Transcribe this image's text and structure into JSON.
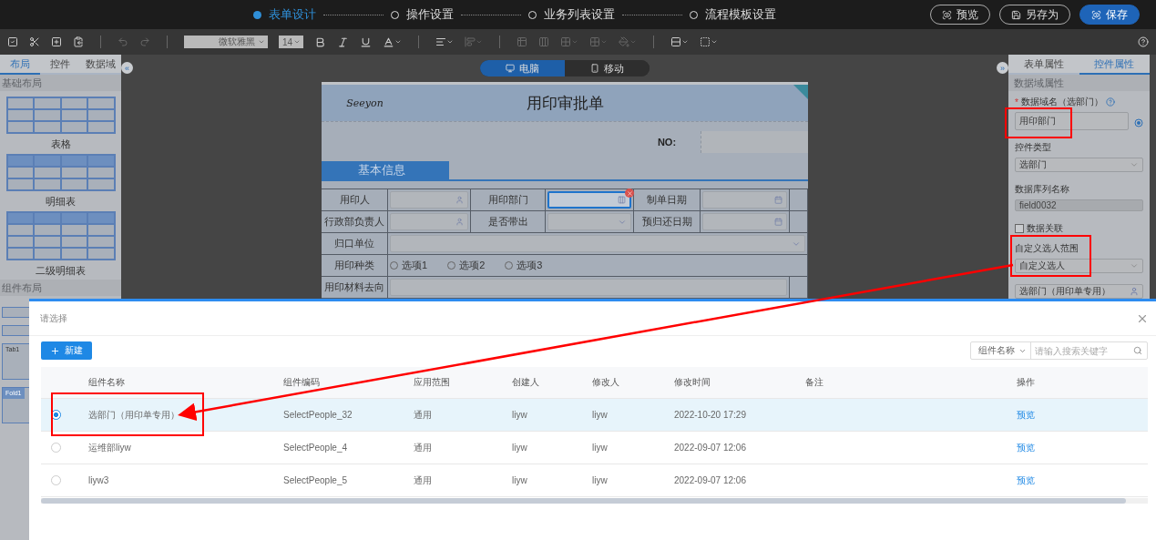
{
  "top_bar": {
    "steps": [
      {
        "label": "表单设计",
        "selected": true
      },
      {
        "label": "操作设置",
        "selected": false
      },
      {
        "label": "业务列表设置",
        "selected": false
      },
      {
        "label": "流程模板设置",
        "selected": false
      }
    ],
    "buttons": [
      {
        "label": "预览",
        "kind": "outline"
      },
      {
        "label": "另存为",
        "kind": "save-as"
      },
      {
        "label": "保存",
        "kind": "primary"
      }
    ]
  },
  "toolbar": {
    "font": "微软雅黑",
    "size": "14"
  },
  "left_panel": {
    "tabs": [
      {
        "label": "布局",
        "selected": true
      },
      {
        "label": "控件",
        "selected": false
      },
      {
        "label": "数据域",
        "selected": false
      }
    ],
    "section": "基础布局",
    "items": [
      {
        "label": "表格",
        "kind": "table"
      },
      {
        "label": "明细表",
        "kind": "detail"
      },
      {
        "label": "二级明细表",
        "kind": "detail2"
      }
    ],
    "section_2": "组件布局",
    "collapse": "«",
    "components": [
      {
        "kind": "bar"
      },
      {
        "kind": "bar"
      },
      {
        "label": "Tab1",
        "kind": "tab"
      },
      {
        "label": "Fold1",
        "kind": "fold"
      }
    ]
  },
  "view_toggle": [
    {
      "label": "电脑",
      "kind": "desktop",
      "selected": true
    },
    {
      "label": "移动",
      "kind": "mobile",
      "selected": false
    }
  ],
  "form": {
    "logo": "Seeyon",
    "title": "用印审批单",
    "no_label": "NO:",
    "section": "基本信息",
    "rows": [
      [
        {
          "kind": "label",
          "text": "用印人"
        },
        {
          "kind": "person",
          "selected": false
        },
        {
          "kind": "label",
          "text": "用印部门"
        },
        {
          "kind": "dept",
          "selected": true
        },
        {
          "kind": "label",
          "text": "制单日期"
        },
        {
          "kind": "date",
          "selected": false
        }
      ],
      [
        {
          "kind": "label",
          "text": "行政部负责人"
        },
        {
          "kind": "person",
          "selected": false
        },
        {
          "kind": "label",
          "text": "是否带出"
        },
        {
          "kind": "select",
          "selected": false
        },
        {
          "kind": "label",
          "text": "预归还日期"
        },
        {
          "kind": "date",
          "selected": false
        }
      ],
      [
        {
          "kind": "label",
          "text": "归口单位"
        },
        {
          "kind": "select",
          "selected": false
        }
      ],
      [
        {
          "kind": "label",
          "text": "用印种类"
        },
        {
          "kind": "radios",
          "selected": false,
          "options": [
            {
              "label": "选项1",
              "checked": false
            },
            {
              "label": "选项2",
              "checked": false
            },
            {
              "label": "选项3",
              "checked": false
            }
          ]
        }
      ],
      [
        {
          "kind": "label",
          "text": "用印材料去向"
        },
        {
          "kind": "text",
          "selected": false
        }
      ]
    ]
  },
  "right_panel": {
    "tabs": [
      {
        "label": "表单属性",
        "selected": false
      },
      {
        "label": "控件属性",
        "selected": true
      }
    ],
    "section": "数据域属性",
    "expand": "»",
    "fields": [
      {
        "kind": "name",
        "label": "数据域名（选部门）",
        "required_mark": "*",
        "value": "用印部门"
      },
      {
        "kind": "select",
        "label": "控件类型",
        "value": "选部门"
      },
      {
        "kind": "readonly",
        "label": "数据库列名称",
        "value": "field0032"
      },
      {
        "kind": "checkbox",
        "label": "数据关联",
        "checked": false
      },
      {
        "kind": "select",
        "label": "自定义选人范围",
        "value": "自定义选人"
      },
      {
        "kind": "picker",
        "value": "选部门（用印单专用）"
      }
    ]
  },
  "dialog": {
    "title": "请选择",
    "new_button": "新建",
    "search_field": "组件名称",
    "search_placeholder": "请输入搜索关键字",
    "columns": [
      "组件名称",
      "组件编码",
      "应用范围",
      "创建人",
      "修改人",
      "修改时间",
      "备注",
      "操作"
    ],
    "rows": [
      {
        "selected": true,
        "cells": [
          "选部门（用印单专用）",
          "SelectPeople_32",
          "通用",
          "liyw",
          "liyw",
          "2022-10-20 17:29",
          "",
          "预览"
        ]
      },
      {
        "selected": false,
        "cells": [
          "运维部liyw",
          "SelectPeople_4",
          "通用",
          "liyw",
          "liyw",
          "2022-09-07 12:06",
          "",
          "预览"
        ]
      },
      {
        "selected": false,
        "cells": [
          "liyw3",
          "SelectPeople_5",
          "通用",
          "liyw",
          "liyw",
          "2022-09-07 12:06",
          "",
          "预览"
        ]
      }
    ]
  }
}
